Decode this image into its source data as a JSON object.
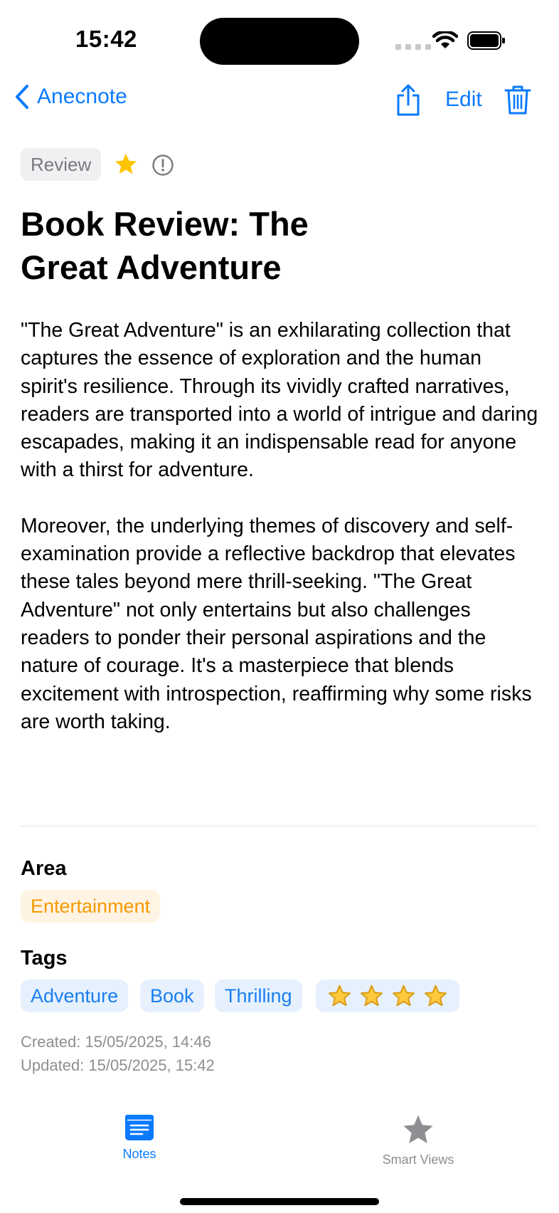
{
  "status": {
    "time": "15:42"
  },
  "nav": {
    "back_label": "Anecnote",
    "edit_label": "Edit"
  },
  "note": {
    "type": "Review",
    "favorite": true,
    "title": "Book Review: The Great Adventure",
    "paragraphs": [
      "\"The Great Adventure\" is an exhilarating collection that captures the essence of exploration and the human spirit's resilience. Through its vividly crafted narratives, readers are transported into a world of intrigue and daring escapades, making it an indispensable read for anyone with a thirst for adventure.",
      "Moreover, the underlying themes of discovery and self-examination provide a reflective backdrop that elevates these tales beyond mere thrill-seeking. \"The Great Adventure\" not only entertains but also challenges readers to ponder their personal aspirations and the nature of courage. It's a masterpiece that blends excitement with introspection, reaffirming why some risks are worth taking."
    ],
    "area_label": "Area",
    "area": "Entertainment",
    "tags_label": "Tags",
    "tags": [
      "Adventure",
      "Book",
      "Thrilling"
    ],
    "rating_stars": 4,
    "created": "Created: 15/05/2025, 14:46",
    "updated": "Updated: 15/05/2025, 15:42"
  },
  "tabs": [
    {
      "label": "Notes",
      "icon": "notes-icon",
      "active": true
    },
    {
      "label": "Smart Views",
      "icon": "star-icon",
      "active": false
    }
  ],
  "colors": {
    "accent": "#0a7aff",
    "area_text": "#f59a00",
    "area_bg": "#fff3e3",
    "tag_text": "#1a7ef0",
    "tag_bg": "#e6f1fd",
    "favorite": "#ffc400",
    "secondary_text": "#8e8e93"
  }
}
